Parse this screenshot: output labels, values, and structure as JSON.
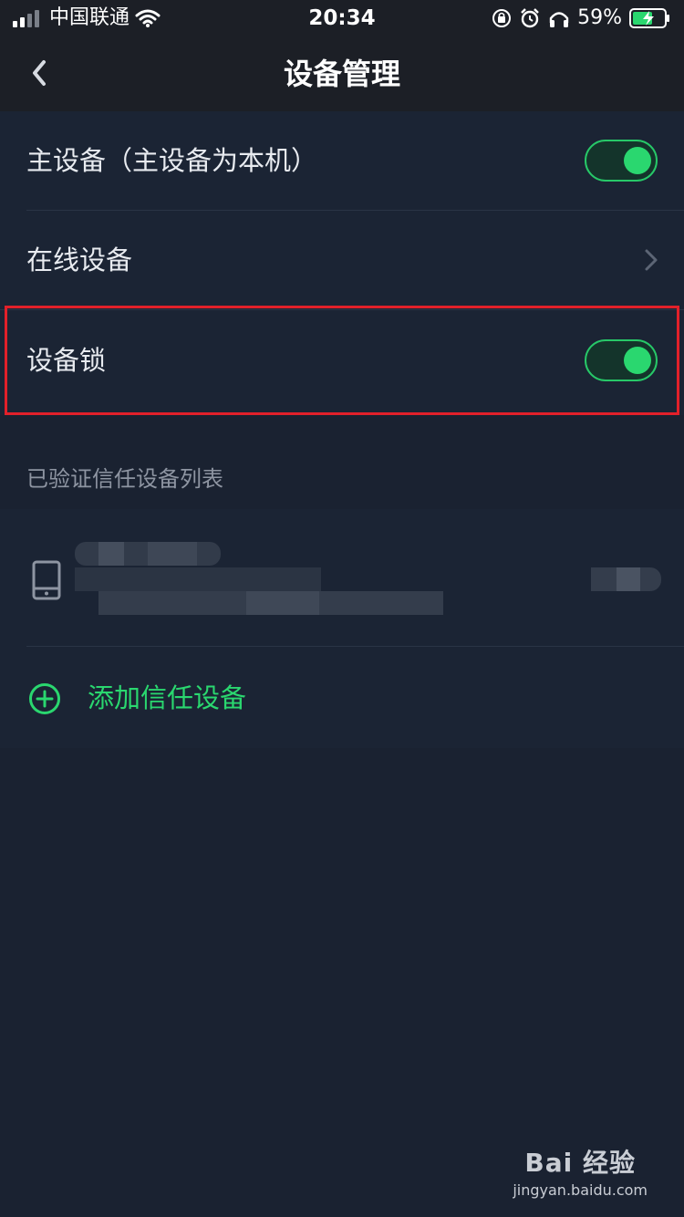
{
  "status_bar": {
    "carrier": "中国联通",
    "time": "20:34",
    "battery_pct": "59%",
    "icons": [
      "signal-icon",
      "wifi-icon",
      "orientation-lock-icon",
      "alarm-icon",
      "headphones-icon",
      "battery-charging-icon"
    ]
  },
  "nav": {
    "title": "设备管理",
    "back_icon": "chevron-left-icon"
  },
  "settings": {
    "primary_device_label": "主设备（主设备为本机）",
    "primary_device_enabled": true,
    "online_devices_label": "在线设备",
    "device_lock_label": "设备锁",
    "device_lock_enabled": true
  },
  "trusted": {
    "section_title": "已验证信任设备列表",
    "device_icon": "phone-icon",
    "add_label": "添加信任设备",
    "add_icon": "plus-circle-icon"
  },
  "watermark": {
    "logo_text": "Bai 经验",
    "url": "jingyan.baidu.com"
  },
  "colors": {
    "background": "#1a2231",
    "card": "#1b2434",
    "accent_green": "#2ad76f",
    "highlight_red": "#e2202a"
  }
}
